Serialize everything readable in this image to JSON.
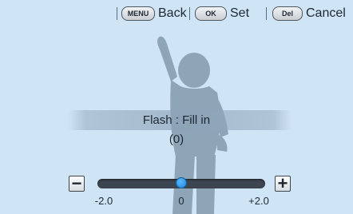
{
  "topbar": {
    "back": {
      "key": "MENU",
      "label": "Back"
    },
    "set": {
      "key": "OK",
      "label": "Set"
    },
    "cancel": {
      "key": "Del",
      "label": "Cancel"
    }
  },
  "flash": {
    "label": "Flash : Fill in",
    "value": "(0)"
  },
  "slider": {
    "minus": "−",
    "plus": "+",
    "ticks": [
      "-2.0",
      "0",
      "+2.0"
    ],
    "min": -2.0,
    "max": 2.0,
    "current": 0
  },
  "colors": {
    "background": "#cfe4f5",
    "silhouette": "#8ea5b8",
    "knob": "#1e86d6"
  }
}
